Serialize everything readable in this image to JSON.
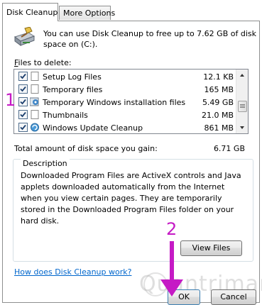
{
  "tabs": [
    {
      "label": "Disk Cleanup",
      "active": true
    },
    {
      "label": "More Options",
      "active": false
    }
  ],
  "header": {
    "icon": "disk-cleanup-drive-icon",
    "text": "You can use Disk Cleanup to free up to 7.62 GB of disk space on  (C:)."
  },
  "files": {
    "label_hotkey": "F",
    "label_rest": "iles to delete:",
    "items": [
      {
        "name": "Setup Log Files",
        "size": "12.1 KB",
        "checked": true,
        "icon": "blank-file-icon"
      },
      {
        "name": "Temporary files",
        "size": "165 MB",
        "checked": true,
        "icon": "blank-file-icon"
      },
      {
        "name": "Temporary Windows installation files",
        "size": "5.49 GB",
        "checked": true,
        "icon": "windows-setup-icon"
      },
      {
        "name": "Thumbnails",
        "size": "21.0 MB",
        "checked": true,
        "icon": "blank-file-icon"
      },
      {
        "name": "Windows Update Cleanup",
        "size": "861 MB",
        "checked": true,
        "icon": "windows-update-icon"
      }
    ]
  },
  "total": {
    "label": "Total amount of disk space you gain:",
    "value": "6.71 GB"
  },
  "description": {
    "title": "Description",
    "text": "Downloaded Program Files are ActiveX controls and Java applets downloaded automatically from the Internet when you view certain pages. They are temporarily stored in the Downloaded Program Files folder on your hard disk."
  },
  "buttons": {
    "view_files": "View Files",
    "ok": "OK",
    "cancel": "Cancel"
  },
  "help_link": "How does Disk Cleanup work?",
  "annotations": {
    "step1": "1",
    "step2": "2",
    "color": "#c51ac5"
  },
  "watermark": "Quantrimang"
}
